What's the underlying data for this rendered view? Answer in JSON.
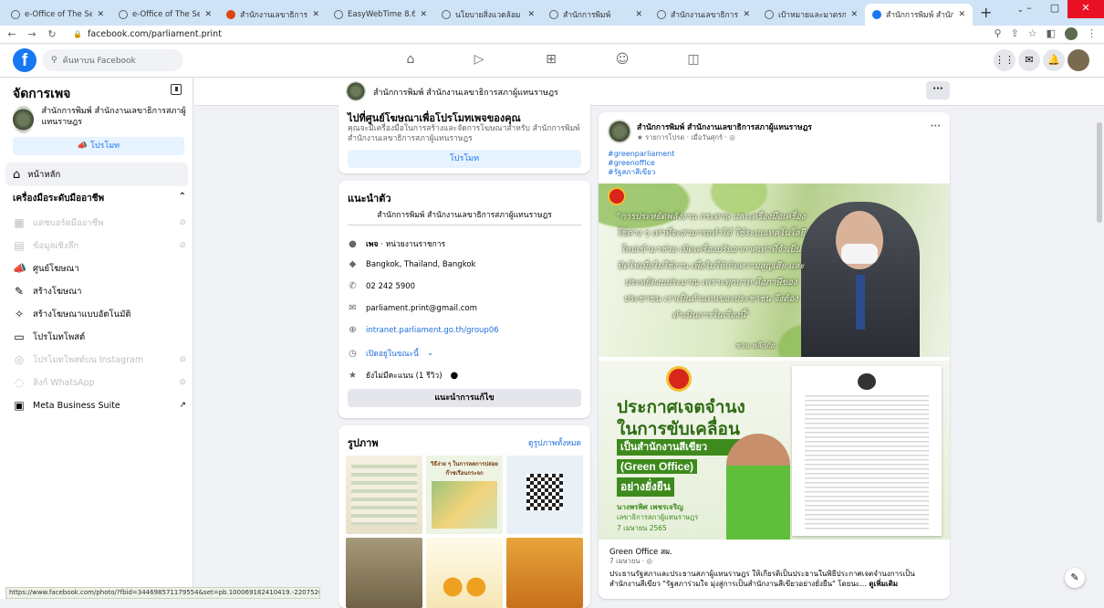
{
  "browser": {
    "tabs": [
      {
        "title": "e-Office of The Secreta",
        "active": false
      },
      {
        "title": "e-Office of The Secreta",
        "active": false
      },
      {
        "title": "สำนักงานเลขาธิการ",
        "active": false,
        "red": true
      },
      {
        "title": "EasyWebTime 8.6",
        "active": false
      },
      {
        "title": "นโยบายสิ่งแวดล้อม",
        "active": false
      },
      {
        "title": "สำนักการพิมพ์",
        "active": false
      },
      {
        "title": "สำนักงานเลขาธิการ",
        "active": false
      },
      {
        "title": "เป้าหมายและมาตรการจัดการ",
        "active": false
      },
      {
        "title": "สำนักการพิมพ์ สำนักงานเลขา",
        "active": true
      }
    ],
    "url": "facebook.com/parliament.print"
  },
  "fb": {
    "search_placeholder": "ค้นหาบน Facebook"
  },
  "sidebar": {
    "title": "จัดการเพจ",
    "page_name": "สำนักการพิมพ์ สำนักงานเลขาธิการสภาผู้แทนราษฎร",
    "promote": "โปรโมท",
    "home": "หน้าหลัก",
    "tools_header": "เครื่องมือระดับมืออาชีพ",
    "items": [
      {
        "label": "แดชบอร์ดมืออาชีพ",
        "disabled": true
      },
      {
        "label": "ข้อมูลเชิงลึก",
        "disabled": true
      },
      {
        "label": "ศูนย์โฆษณา",
        "disabled": false
      },
      {
        "label": "สร้างโฆษณา",
        "disabled": false
      },
      {
        "label": "สร้างโฆษณาแบบอัตโนมัติ",
        "disabled": false
      },
      {
        "label": "โปรโมทโพสต์",
        "disabled": false
      },
      {
        "label": "โปรโมทโพสต์บน Instagram",
        "disabled": true
      },
      {
        "label": "ลิงก์ WhatsApp",
        "disabled": true
      },
      {
        "label": "Meta Business Suite",
        "disabled": false
      }
    ]
  },
  "page_header": {
    "name": "สำนักการพิมพ์ สำนักงานเลขาธิการสภาผู้แทนราษฎร",
    "more": "···"
  },
  "ad_center": {
    "title": "ไปที่ศูนย์โฆษณาเพื่อโปรโมทเพจของคุณ",
    "desc": "คุณจะมีเครื่องมือในการสร้างและจัดการโฆษณาสำหรับ สำนักการพิมพ์ สำนักงานเลขาธิการสภาผู้แทนราษฎร",
    "button": "โปรโมท"
  },
  "intro": {
    "title": "แนะนำตัว",
    "bio": "สำนักการพิมพ์ สำนักงานเลขาธิการสภาผู้แทนราษฎร",
    "category_bold": "เพจ",
    "category": " · หน่วยงานราชการ",
    "location": "Bangkok, Thailand, Bangkok",
    "phone": "02 242 5900",
    "email": "parliament.print@gmail.com",
    "website": "intranet.parliament.go.th/group06",
    "hours": "เปิดอยู่ในขณะนี้",
    "rating": "ยังไม่มีคะแนน (1 รีวิว)",
    "edit_button": "แนะนำการแก้ไข"
  },
  "photos": {
    "title": "รูปภาพ",
    "see_all": "ดูรูปภาพทั้งหมด",
    "thumb_text_1": "วิธีง่าย ๆ ในการลดการปล่อยก๊าซเรือนกระจก"
  },
  "post": {
    "author": "สำนักการพิมพ์ สำนักงานเลขาธิการสภาผู้แทนราษฎร",
    "meta": "★ รายการโปรด · เมื่อวันศุกร์ · ◎",
    "hashtags": [
      "#greenparliament",
      "#greenoffice",
      "#รัฐสภาสีเขียว"
    ],
    "quote": "\"การประหยัดพลังงาน กระดาษ และเครื่องมือเครื่องใช้ต่าง ๆ เท่าที่จะสามารถทำได้ ใช้ระบบเทคโนโลยีใหม่เข้ามาช่วย เปิดเครื่องปรับอากาศเท่าที่จำเป็น ปิดไฟเมื่อไม่ใช้งาน เพื่อไม่ให้เกิดความสูญเสีย และประหยัดงบประมาณ เพราะทุกบาท คือภาษีของประชาชน เราเป็นตัวแทนของประชาชน จึงต้องดำเนินการในเรื่องนี้\"",
    "quote_author": "ชวน หลีกภัย",
    "poster_line1": "ประกาศเจตจำนง",
    "poster_line2": "ในการขับเคลื่อน",
    "poster_line3": "เป็นสำนักงานสีเขียว",
    "poster_line4": "(Green Office)",
    "poster_line5": "อย่างยั่งยืน",
    "poster_name": "นางพรพิศ เพชรเจริญ",
    "poster_role": "เลขาธิการสภาผู้แทนราษฎร",
    "poster_date": "7 เมษายน 2565",
    "album_title": "Green Office สผ.",
    "album_date": "7 เมษายน · ◎",
    "album_desc": "ประธานรัฐสภาและประธานสภาผู้แทนราษฎร ให้เกียรติเป็นประธานในพิธีประกาศเจตจำนงการเป็นสำนักงานสีเขียว \"รัฐสภาร่วมใจ มุ่งสู่การเป็นสำนักงานสีเขียวอย่างยั่งยืน\" โดยนะ...",
    "see_more": "ดูเพิ่มเติม"
  },
  "status_url": "https://www.facebook.com/photo/?fbid=344698571179554&set=pb.100069182410419.-2207520000..."
}
